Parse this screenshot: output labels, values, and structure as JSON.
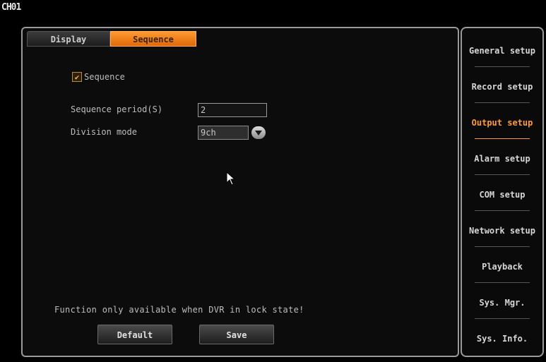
{
  "channel": "CH01",
  "tabs": [
    {
      "label": "Display",
      "active": false
    },
    {
      "label": "Sequence",
      "active": true
    }
  ],
  "sequence_checkbox": {
    "label": "Sequence",
    "checked": true
  },
  "sequence_period": {
    "label": "Sequence period(S)",
    "value": "2"
  },
  "division_mode": {
    "label": "Division mode",
    "selected": "9ch"
  },
  "notice": "Function only available when DVR in lock state!",
  "buttons": {
    "default": "Default",
    "save": "Save"
  },
  "sidebar": {
    "items": [
      {
        "label": "General setup",
        "active": false
      },
      {
        "label": "Record setup",
        "active": false
      },
      {
        "label": "Output setup",
        "active": true
      },
      {
        "label": "Alarm setup",
        "active": false
      },
      {
        "label": "COM setup",
        "active": false
      },
      {
        "label": "Network setup",
        "active": false
      },
      {
        "label": "Playback",
        "active": false
      },
      {
        "label": "Sys. Mgr.",
        "active": false
      },
      {
        "label": "Sys. Info.",
        "active": false
      }
    ]
  },
  "colors": {
    "accent": "#ff9a30",
    "background": "#000000",
    "border": "#9a9a9a"
  },
  "icons": {
    "checkbox": "checkmark-icon",
    "dropdown": "chevron-down-icon",
    "pointer": "mouse-cursor-icon"
  }
}
